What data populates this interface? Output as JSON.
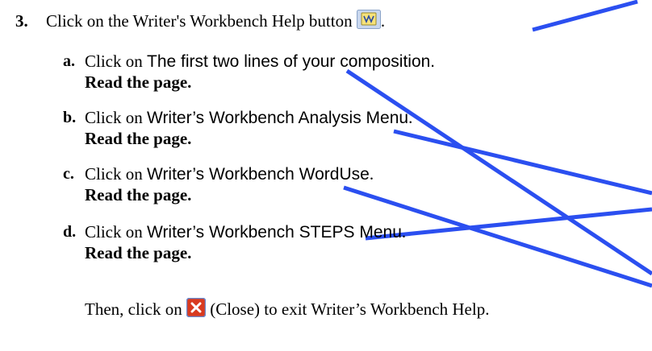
{
  "step3": {
    "number": "3.",
    "text_prefix": "Click on the Writer's Workbench Help button",
    "text_suffix": ".",
    "icon": "writers-workbench-help-icon"
  },
  "substeps": [
    {
      "letter": "a.",
      "prefix": "Click on ",
      "link": "The first two lines of your composition.",
      "suffix": "",
      "instruction": "Read the page."
    },
    {
      "letter": "b.",
      "prefix": "Click on ",
      "link": "Writer’s Workbench Analysis Menu",
      "suffix": ".",
      "instruction": "Read the page."
    },
    {
      "letter": "c.",
      "prefix": "Click on ",
      "link": "Writer’s Workbench WordUse",
      "suffix": ".",
      "instruction": "Read the page."
    },
    {
      "letter": "d.",
      "prefix": "Click on ",
      "link": "Writer’s Workbench STEPS Menu",
      "suffix": ".",
      "instruction": "Read the page."
    }
  ],
  "closing": {
    "prefix": "Then, click on ",
    "icon": "close-icon",
    "suffix": " (Close) to exit Writer’s Workbench Help."
  },
  "colors": {
    "arrow": "#2b4ff0",
    "close_icon_bg": "#d93a1f",
    "icon_bg": "#c9d7ee"
  }
}
